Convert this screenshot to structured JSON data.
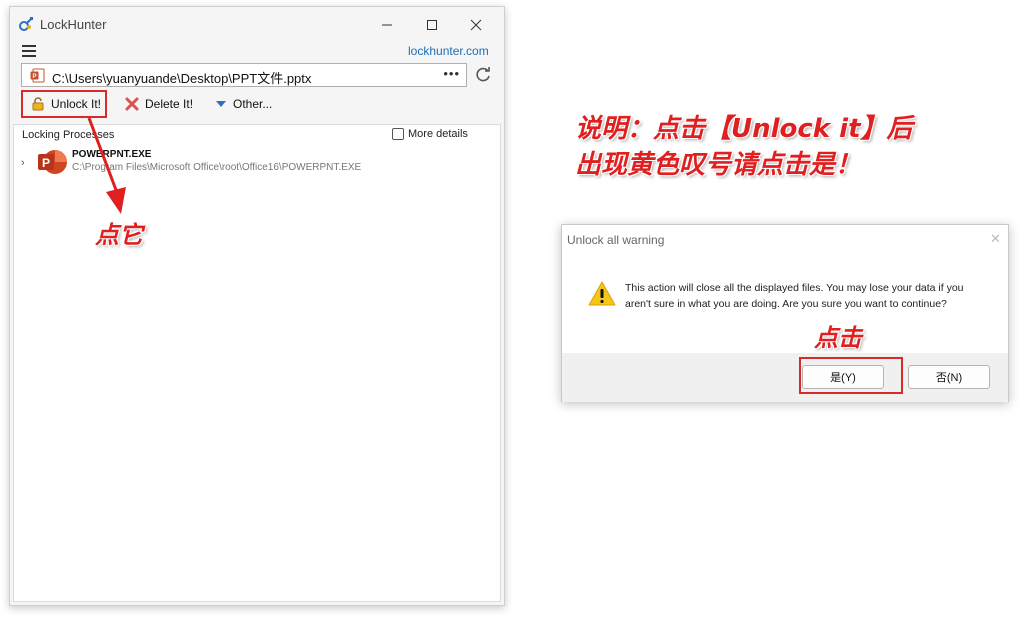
{
  "lockhunter": {
    "title": "LockHunter",
    "link": "lockhunter.com",
    "path": "C:\\Users\\yuanyuande\\Desktop\\PPT文件.pptx",
    "path_more": "•••",
    "toolbar": {
      "unlock_label": "Unlock It!",
      "delete_label": "Delete It!",
      "other_label": "Other..."
    },
    "list": {
      "header": "Locking Processes",
      "more_details": "More details",
      "process_name": "POWERPNT.EXE",
      "process_path": "C:\\Program Files\\Microsoft Office\\root\\Office16\\POWERPNT.EXE"
    }
  },
  "annotations": {
    "click_it": "点它",
    "desc_line1": "说明：点击【Unlock it】后",
    "desc_line2": "出现黄色叹号请点击是！",
    "click": "点击"
  },
  "dialog": {
    "title": "Unlock all warning",
    "message": "This action will close all the displayed files. You may lose your data if you aren't sure in what you are doing. Are you sure you want to continue?",
    "yes_label": "是(Y)",
    "no_label": "否(N)"
  },
  "colors": {
    "annotation_red": "#e02020",
    "highlight_border": "#d52b2b",
    "link_blue": "#1d6fb5",
    "warning_yellow": "#f5c518"
  }
}
